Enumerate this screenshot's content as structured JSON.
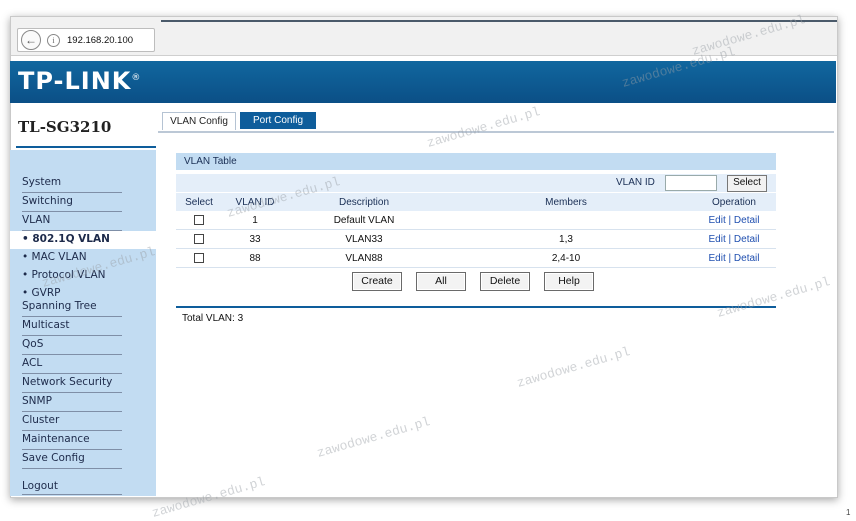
{
  "browser": {
    "url": "192.168.20.100"
  },
  "brand": {
    "logo": "TP-LINK",
    "model": "TL-SG3210"
  },
  "tabs": [
    {
      "label": "VLAN Config"
    },
    {
      "label": "Port Config"
    }
  ],
  "sidebar": {
    "items": [
      {
        "label": "System"
      },
      {
        "label": "Switching"
      },
      {
        "label": "VLAN"
      },
      {
        "label": "• 802.1Q VLAN"
      },
      {
        "label": "• MAC VLAN"
      },
      {
        "label": "• Protocol VLAN"
      },
      {
        "label": "• GVRP"
      },
      {
        "label": "Spanning Tree"
      },
      {
        "label": "Multicast"
      },
      {
        "label": "QoS"
      },
      {
        "label": "ACL"
      },
      {
        "label": "Network Security"
      },
      {
        "label": "SNMP"
      },
      {
        "label": "Cluster"
      },
      {
        "label": "Maintenance"
      },
      {
        "label": "Save Config"
      }
    ],
    "logout": "Logout"
  },
  "vlan_table": {
    "title": "VLAN Table",
    "vlan_id_label": "VLAN ID",
    "vlan_id_value": "",
    "select_button": "Select",
    "columns": [
      "Select",
      "VLAN ID",
      "Description",
      "Members",
      "Operation"
    ],
    "rows": [
      {
        "vlan_id": "1",
        "description": "Default VLAN",
        "members": "",
        "edit": "Edit",
        "sep": "|",
        "detail": "Detail"
      },
      {
        "vlan_id": "33",
        "description": "VLAN33",
        "members": "1,3",
        "edit": "Edit",
        "sep": "|",
        "detail": "Detail"
      },
      {
        "vlan_id": "88",
        "description": "VLAN88",
        "members": "2,4-10",
        "edit": "Edit",
        "sep": "|",
        "detail": "Detail"
      }
    ]
  },
  "buttons": {
    "create": "Create",
    "all": "All",
    "delete": "Delete",
    "help": "Help"
  },
  "total": "Total VLAN: 3",
  "watermark": "zawodowe.edu.pl",
  "edge_char": "1",
  "colors": {
    "brand_blue": "#0e5d9b",
    "sidebar_bg": "#c2dcf2",
    "link": "#1f4fb0"
  }
}
